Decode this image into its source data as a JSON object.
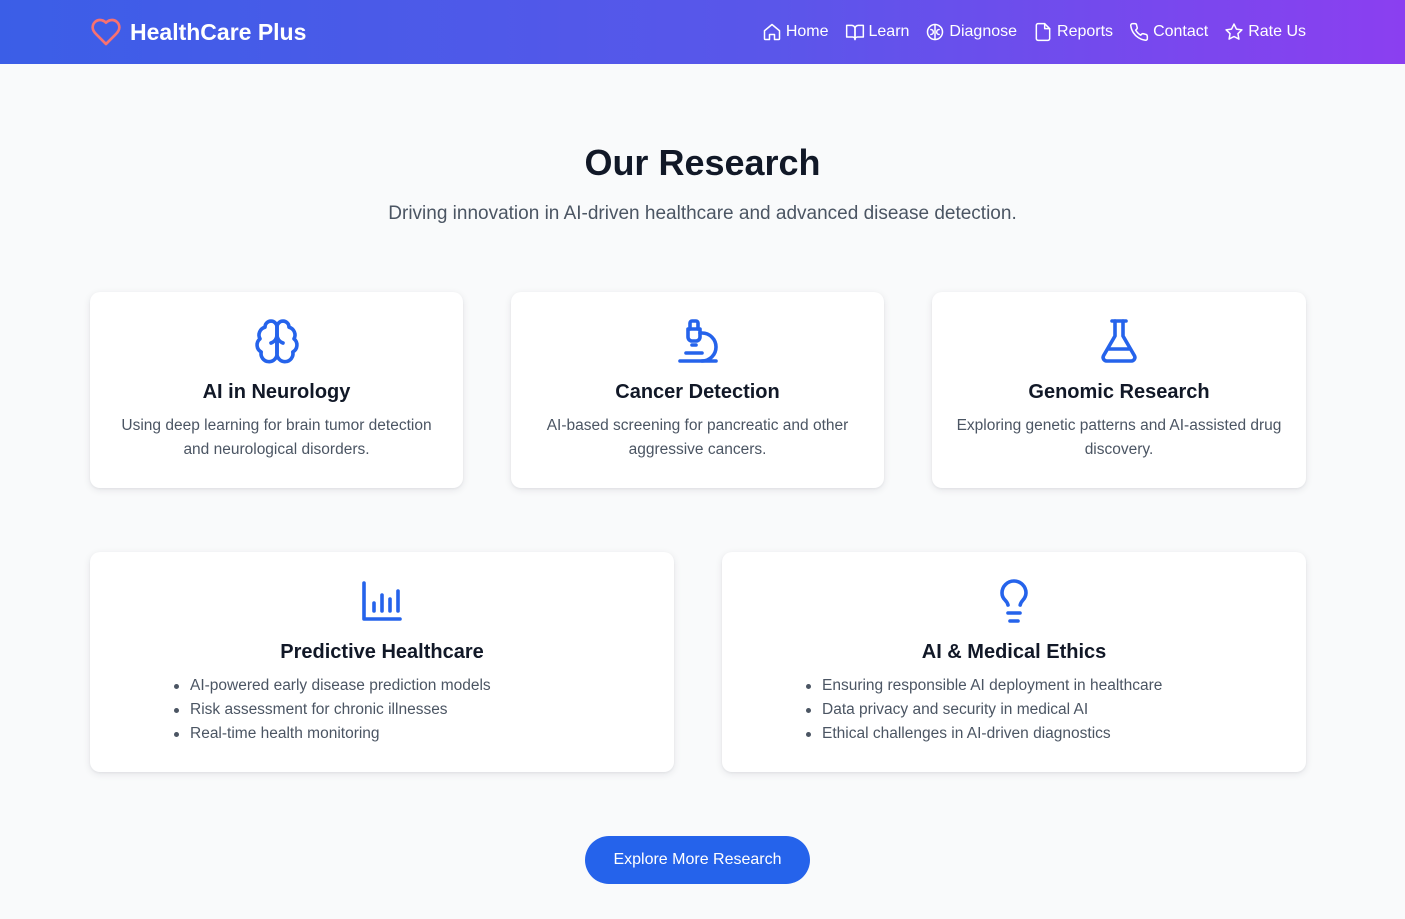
{
  "nav": {
    "brand": "HealthCare Plus",
    "links": [
      {
        "label": "Home",
        "icon": "home-icon"
      },
      {
        "label": "Learn",
        "icon": "book-icon"
      },
      {
        "label": "Diagnose",
        "icon": "brain-icon"
      },
      {
        "label": "Reports",
        "icon": "document-icon"
      },
      {
        "label": "Contact",
        "icon": "phone-icon"
      },
      {
        "label": "Rate Us",
        "icon": "star-icon"
      }
    ]
  },
  "hero": {
    "title": "Our Research",
    "subtitle": "Driving innovation in AI-driven healthcare and advanced disease detection."
  },
  "cards": [
    {
      "title": "AI in Neurology",
      "icon": "brain-icon",
      "description": "Using deep learning for brain tumor detection and neurological disorders."
    },
    {
      "title": "Cancer Detection",
      "icon": "microscope-icon",
      "description": "AI-based screening for pancreatic and other aggressive cancers."
    },
    {
      "title": "Genomic Research",
      "icon": "flask-icon",
      "description": "Exploring genetic patterns and AI-assisted drug discovery."
    },
    {
      "title": "Predictive Healthcare",
      "icon": "bar-chart-icon",
      "items": [
        "AI-powered early disease prediction models",
        "Risk assessment for chronic illnesses",
        "Real-time health monitoring"
      ]
    },
    {
      "title": "AI & Medical Ethics",
      "icon": "lightbulb-icon",
      "items": [
        "Ensuring responsible AI deployment in healthcare",
        "Data privacy and security in medical AI",
        "Ethical challenges in AI-driven diagnostics"
      ]
    }
  ],
  "cta": {
    "label": "Explore More Research"
  },
  "colors": {
    "accent": "#2563eb",
    "brand_heart": "#f87171",
    "gradient_start": "#3b5ee7",
    "gradient_end": "#8b3ff0"
  }
}
